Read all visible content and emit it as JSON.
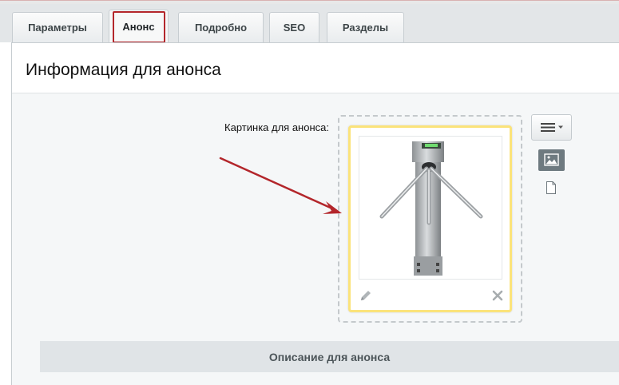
{
  "tabs": [
    {
      "label": "Параметры",
      "active": false
    },
    {
      "label": "Анонс",
      "active": true
    },
    {
      "label": "Подробно",
      "active": false
    },
    {
      "label": "SEO",
      "active": false
    },
    {
      "label": "Разделы",
      "active": false
    }
  ],
  "section": {
    "title": "Информация для анонса",
    "preview_image_label": "Картинка для анонса:",
    "description_header": "Описание для анонса"
  },
  "colors": {
    "active_tab_outline": "#b3262b",
    "image_card_border": "#fbe37a",
    "annotation_arrow": "#b3262b"
  },
  "icons": {
    "menu": "hamburger-menu-icon",
    "image_mode": "image-icon",
    "file_mode": "file-icon",
    "edit": "pencil-icon",
    "delete": "close-icon"
  }
}
